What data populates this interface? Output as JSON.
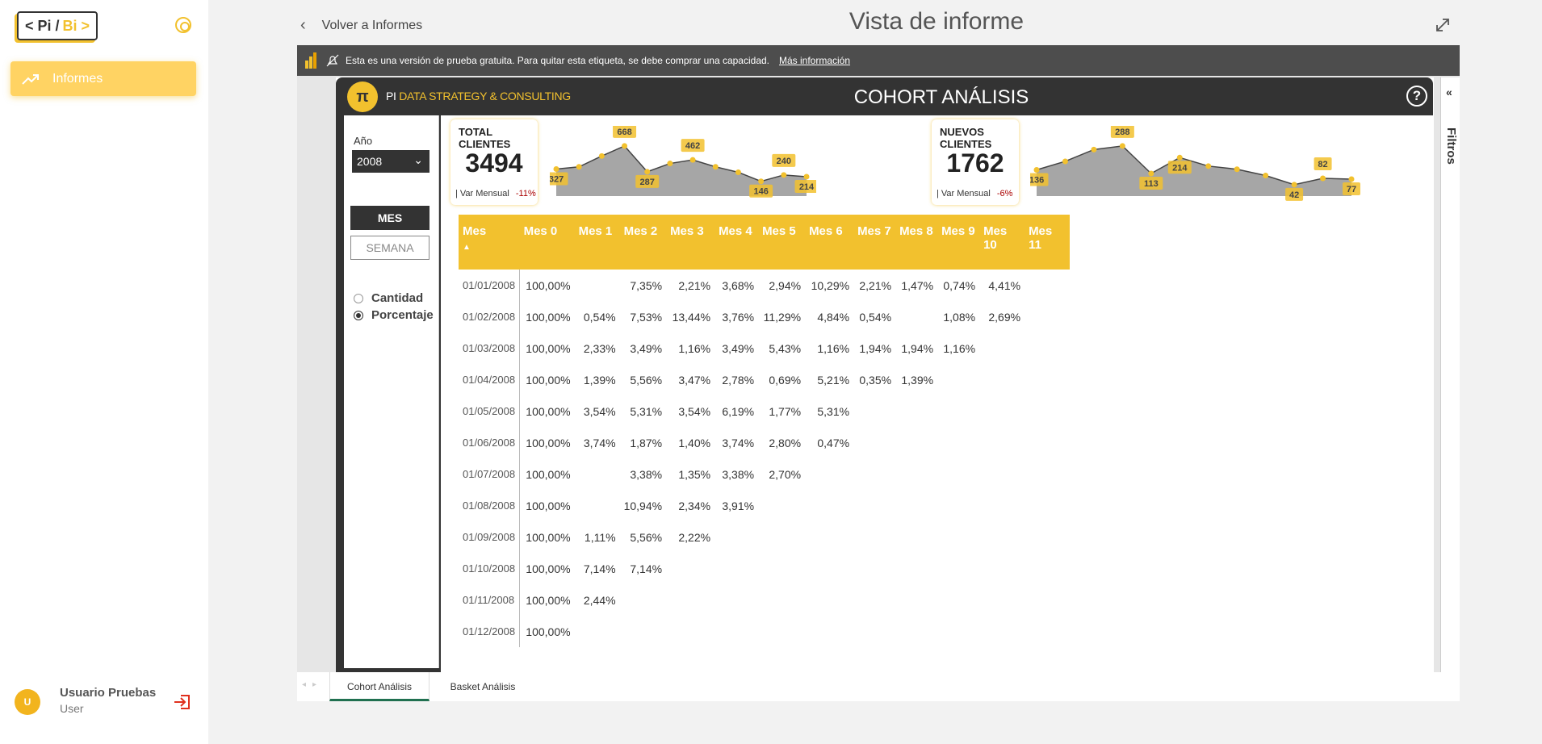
{
  "sidebar": {
    "logo": {
      "left": "< Pi /",
      "right": "Bi >"
    },
    "items": [
      {
        "label": "Informes"
      }
    ],
    "user": {
      "initial": "U",
      "name": "Usuario Pruebas",
      "role": "User"
    }
  },
  "header": {
    "back_label": "Volver a Informes",
    "title": "Vista de informe"
  },
  "trial_banner": {
    "text": "Esta es una versión de prueba gratuita. Para quitar esta etiqueta, se debe comprar una capacidad.",
    "link": "Más información"
  },
  "report": {
    "brand_icon": "π",
    "brand_prefix": "PI",
    "brand_rest": "DATA STRATEGY & CONSULTING",
    "title": "COHORT ANÁLISIS",
    "help": "?",
    "filters_label": "Filtros",
    "slicer": {
      "year_label": "Año",
      "year_value": "2008",
      "buttons": [
        "MES",
        "SEMANA"
      ],
      "radios": [
        {
          "label": "Cantidad",
          "selected": false
        },
        {
          "label": "Porcentaje",
          "selected": true
        }
      ]
    },
    "kpis": [
      {
        "title": "TOTAL CLIENTES",
        "value": "3494",
        "sub_label": "| Var Mensual",
        "sub_value": "-11%"
      },
      {
        "title": "NUEVOS CLIENTES",
        "value": "1762",
        "sub_label": "| Var Mensual",
        "sub_value": "-6%"
      }
    ],
    "table": {
      "headers": [
        "Mes",
        "Mes 0",
        "Mes 1",
        "Mes 2",
        "Mes 3",
        "Mes 4",
        "Mes 5",
        "Mes 6",
        "Mes 7",
        "Mes 8",
        "Mes 9",
        "Mes 10",
        "Mes 11"
      ],
      "rows": [
        [
          "01/01/2008",
          "100,00%",
          "",
          "7,35%",
          "2,21%",
          "3,68%",
          "2,94%",
          "10,29%",
          "2,21%",
          "1,47%",
          "0,74%",
          "4,41%",
          ""
        ],
        [
          "01/02/2008",
          "100,00%",
          "0,54%",
          "7,53%",
          "13,44%",
          "3,76%",
          "11,29%",
          "4,84%",
          "0,54%",
          "",
          "1,08%",
          "2,69%",
          ""
        ],
        [
          "01/03/2008",
          "100,00%",
          "2,33%",
          "3,49%",
          "1,16%",
          "3,49%",
          "5,43%",
          "1,16%",
          "1,94%",
          "1,94%",
          "1,16%",
          "",
          ""
        ],
        [
          "01/04/2008",
          "100,00%",
          "1,39%",
          "5,56%",
          "3,47%",
          "2,78%",
          "0,69%",
          "5,21%",
          "0,35%",
          "1,39%",
          "",
          "",
          ""
        ],
        [
          "01/05/2008",
          "100,00%",
          "3,54%",
          "5,31%",
          "3,54%",
          "6,19%",
          "1,77%",
          "5,31%",
          "",
          "",
          "",
          "",
          ""
        ],
        [
          "01/06/2008",
          "100,00%",
          "3,74%",
          "1,87%",
          "1,40%",
          "3,74%",
          "2,80%",
          "0,47%",
          "",
          "",
          "",
          "",
          ""
        ],
        [
          "01/07/2008",
          "100,00%",
          "",
          "3,38%",
          "1,35%",
          "3,38%",
          "2,70%",
          "",
          "",
          "",
          "",
          "",
          ""
        ],
        [
          "01/08/2008",
          "100,00%",
          "",
          "10,94%",
          "2,34%",
          "3,91%",
          "",
          "",
          "",
          "",
          "",
          "",
          ""
        ],
        [
          "01/09/2008",
          "100,00%",
          "1,11%",
          "5,56%",
          "2,22%",
          "",
          "",
          "",
          "",
          "",
          "",
          "",
          ""
        ],
        [
          "01/10/2008",
          "100,00%",
          "7,14%",
          "7,14%",
          "",
          "",
          "",
          "",
          "",
          "",
          "",
          "",
          ""
        ],
        [
          "01/11/2008",
          "100,00%",
          "2,44%",
          "",
          "",
          "",
          "",
          "",
          "",
          "",
          "",
          "",
          ""
        ],
        [
          "01/12/2008",
          "100,00%",
          "",
          "",
          "",
          "",
          "",
          "",
          "",
          "",
          "",
          "",
          ""
        ]
      ]
    },
    "tabs": [
      {
        "label": "Cohort Análisis",
        "active": true
      },
      {
        "label": "Basket Análisis",
        "active": false
      }
    ]
  },
  "chart_data": [
    {
      "type": "area",
      "name": "total-clientes-sparkline",
      "values": [
        327,
        360,
        520,
        668,
        287,
        410,
        462,
        360,
        280,
        146,
        240,
        214
      ],
      "labels": {
        "0": "327",
        "3": "668",
        "4": "287",
        "6": "462",
        "9": "146",
        "10": "240",
        "11": "214"
      },
      "color": "#a6a6a6",
      "marker_color": "#f2c12e"
    },
    {
      "type": "area",
      "name": "nuevos-clientes-sparkline",
      "values": [
        136,
        190,
        265,
        288,
        113,
        214,
        160,
        140,
        100,
        42,
        82,
        77
      ],
      "labels": {
        "0": "136",
        "3": "288",
        "4": "113",
        "5": "214",
        "9": "42",
        "10": "82",
        "11": "77"
      },
      "color": "#a6a6a6",
      "marker_color": "#f2c12e"
    }
  ]
}
